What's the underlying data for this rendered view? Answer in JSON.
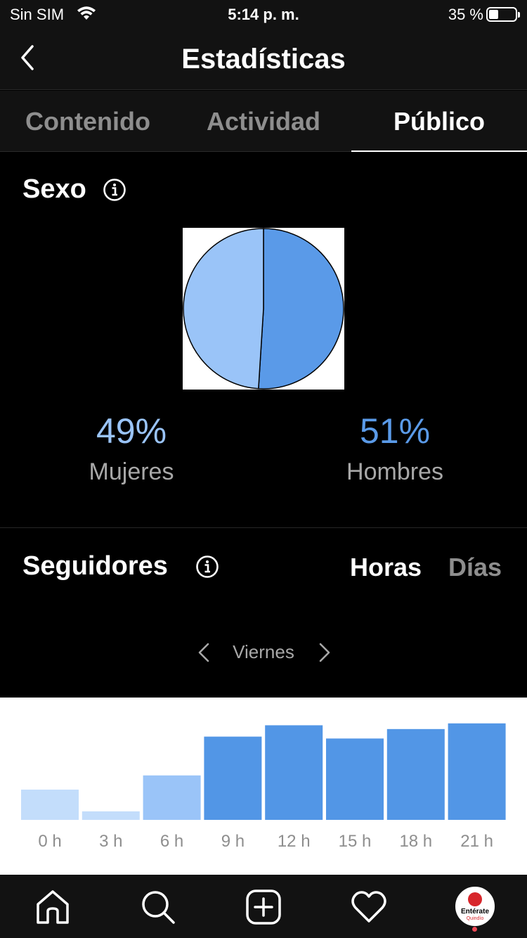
{
  "status_bar": {
    "carrier": "Sin SIM",
    "time": "5:14 p. m.",
    "battery": "35 %",
    "battery_level": 0.35
  },
  "header": {
    "title": "Estadísticas"
  },
  "tabs": [
    {
      "label": "Contenido",
      "active": false
    },
    {
      "label": "Actividad",
      "active": false
    },
    {
      "label": "Público",
      "active": true
    }
  ],
  "gender": {
    "title": "Sexo",
    "women": {
      "value": "49%",
      "label": "Mujeres",
      "color": "#9ac4f8"
    },
    "men": {
      "value": "51%",
      "label": "Hombres",
      "color": "#5a9ae8"
    }
  },
  "followers": {
    "title": "Seguidores",
    "toggle": {
      "hours": "Horas",
      "days": "Días",
      "selected": "hours"
    },
    "day": "Viernes"
  },
  "chart_data": [
    {
      "type": "pie",
      "labels": [
        "Mujeres",
        "Hombres"
      ],
      "values": [
        49,
        51
      ],
      "colors": [
        "#9ac4f8",
        "#5a9ae8"
      ]
    },
    {
      "type": "bar",
      "categories": [
        "0 h",
        "3 h",
        "6 h",
        "9 h",
        "12 h",
        "15 h",
        "18 h",
        "21 h"
      ],
      "values": [
        32,
        9,
        47,
        88,
        100,
        86,
        96,
        102
      ],
      "ylim": [
        0,
        110
      ],
      "colors": [
        "#c3ddfb",
        "#c3ddfb",
        "#9ac4f8",
        "#5296e6",
        "#5296e6",
        "#5296e6",
        "#5296e6",
        "#5296e6"
      ]
    }
  ],
  "bottom_nav": [
    {
      "icon": "home-icon"
    },
    {
      "icon": "search-icon"
    },
    {
      "icon": "add-post-icon"
    },
    {
      "icon": "heart-icon"
    },
    {
      "icon": "profile-avatar"
    }
  ],
  "profile_logo": {
    "text": "Entérate",
    "sub": "Quindío",
    "color": "#d7262b"
  }
}
